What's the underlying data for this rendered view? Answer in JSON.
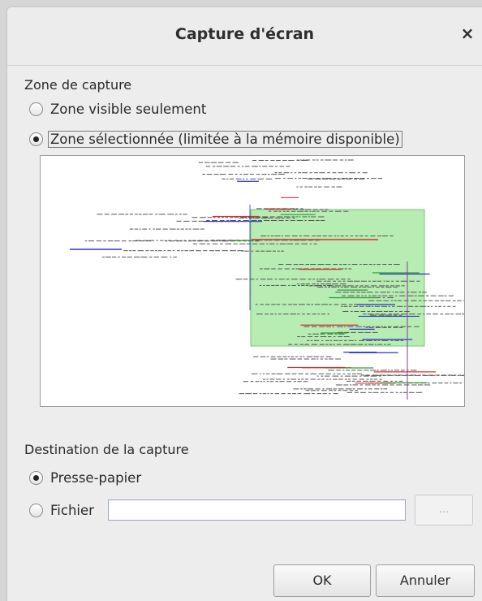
{
  "window": {
    "title": "Capture d'écran",
    "close_symbol": "×"
  },
  "capture_zone": {
    "label": "Zone de capture",
    "options": [
      {
        "label": "Zone visible seulement",
        "checked": false
      },
      {
        "label": "Zone sélectionnée (limitée à la mémoire disponible)",
        "checked": true
      }
    ]
  },
  "preview": {
    "selection_color": "#9fe59a",
    "icon": "mindmap-thumbnail"
  },
  "destination": {
    "label": "Destination de la capture",
    "options": [
      {
        "label": "Presse-papier",
        "checked": true
      },
      {
        "label": "Fichier",
        "checked": false
      }
    ],
    "file_value": "",
    "browse_label": "..."
  },
  "buttons": {
    "ok": "OK",
    "cancel": "Annuler"
  }
}
